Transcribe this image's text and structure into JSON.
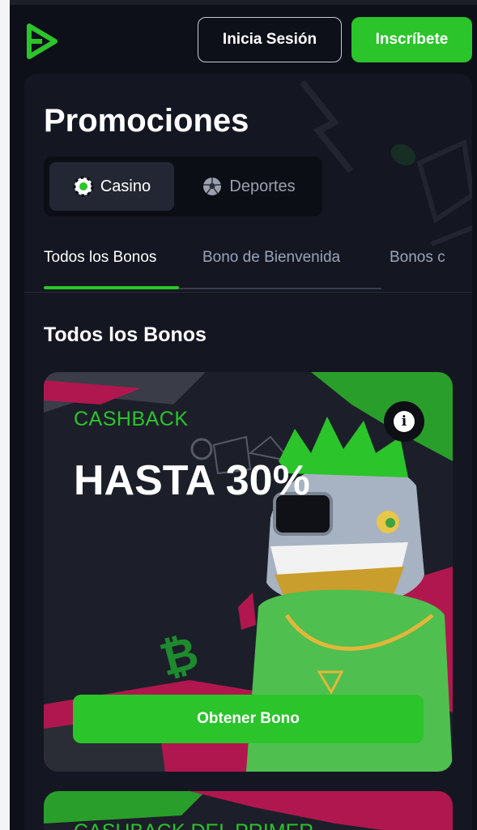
{
  "header": {
    "login_label": "Inicia Sesión",
    "signup_label": "Inscríbete"
  },
  "page": {
    "title": "Promociones"
  },
  "segments": {
    "casino": "Casino",
    "sports": "Deportes"
  },
  "tabs": [
    {
      "label": "Todos los Bonos",
      "active": true
    },
    {
      "label": "Bono de Bienvenida",
      "active": false
    },
    {
      "label": "Bonos c",
      "active": false
    }
  ],
  "section": {
    "title": "Todos los Bonos"
  },
  "promo": {
    "kicker": "CASHBACK",
    "headline": "HASTA 30%",
    "cta_label": "Obtener Bono",
    "info_glyph": "i"
  },
  "promo_next": {
    "kicker": "CASHBACK DEL PRIMER"
  },
  "colors": {
    "accent": "#2bc42b",
    "background": "#0e1019",
    "panel": "#141722",
    "magenta": "#c2185b"
  },
  "icons": [
    "brand-logo-icon",
    "casino-chip-icon",
    "soccer-ball-icon",
    "info-icon"
  ]
}
